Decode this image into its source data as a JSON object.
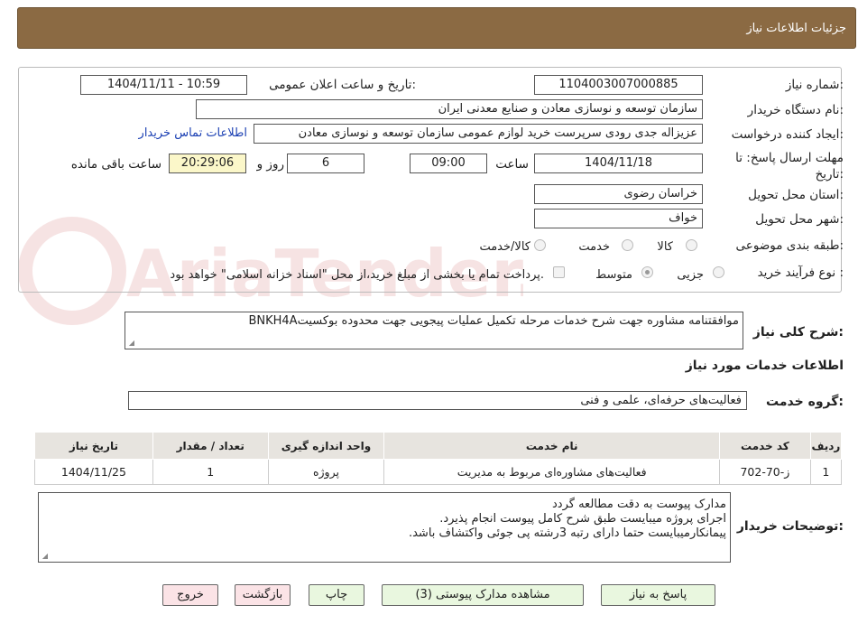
{
  "header": {
    "title": "جزئیات اطلاعات نیاز"
  },
  "form": {
    "need_number_label": "شماره نیاز:",
    "need_number": "1104003007000885",
    "announce_label": "تاریخ و ساعت اعلان عمومی:",
    "announce_value": "1404/11/11 - 10:59",
    "buyer_org_label": "نام دستگاه خریدار:",
    "buyer_org": "سازمان توسعه و نوسازی معادن و صنایع معدنی ایران",
    "requester_label": "ایجاد کننده درخواست:",
    "requester": "عزیزاله جدی رودی سرپرست خرید لوازم عمومی  سازمان توسعه و نوسازی معادن",
    "buyer_contact_link": "اطلاعات تماس خریدار",
    "deadline_label": "مهلت ارسال پاسخ: تا تاریخ:",
    "deadline_date": "1404/11/18",
    "time_label": "ساعت",
    "deadline_time": "09:00",
    "days_value": "6",
    "days_label": "روز و",
    "remaining_time": "20:29:06",
    "remaining_label": "ساعت باقی مانده",
    "province_label": "استان محل تحویل:",
    "province": "خراسان رضوی",
    "city_label": "شهر محل تحویل:",
    "city": "خواف",
    "category_label": "طبقه بندی موضوعی:",
    "category_options": [
      "کالا",
      "خدمت",
      "کالا/خدمت"
    ],
    "purchase_type_label": "نوع فرآیند خرید :",
    "purchase_type_options": [
      "جزیی",
      "متوسط"
    ],
    "treasury_note": "پرداخت تمام یا بخشی از مبلغ خرید،از محل \"اسناد خزانه اسلامی\" خواهد بود."
  },
  "summary": {
    "label": "شرح کلی نیاز:",
    "text": "موافقتنامه مشاوره جهت شرح خدمات مرحله تکمیل عملیات پیجویی جهت محدوده بوکسیتBNKH4A"
  },
  "services": {
    "section_title": "اطلاعات خدمات مورد نیاز",
    "group_label": "گروه خدمت:",
    "group_value": "فعالیت‌های حرفه‌ای، علمی و فنی",
    "columns": [
      "ردیف",
      "کد خدمت",
      "نام خدمت",
      "واحد اندازه گیری",
      "تعداد / مقدار",
      "تاریخ نیاز"
    ],
    "rows": [
      [
        "1",
        "ز-70-702",
        "فعالیت‌های مشاوره‌ای مربوط به مدیریت",
        "پروژه",
        "1",
        "1404/11/25"
      ]
    ]
  },
  "buyer_notes": {
    "label": "توضیحات خریدار:",
    "lines": [
      "مدارک پیوست به دقت مطالعه گردد",
      "اجرای پروژه میبایست طبق شرح کامل پیوست انجام پذیرد.",
      "پیمانکارمیبایست حتما دارای رتبه 3رشته پی جوئی واکتشاف باشد."
    ]
  },
  "buttons": {
    "reply": "پاسخ به نیاز",
    "attachments": "مشاهده مدارک پیوستی (3)",
    "print": "چاپ",
    "back": "بازگشت",
    "exit": "خروج"
  },
  "colors": {
    "header_bg": "#8b6a43",
    "link": "#1a3fb3",
    "button_green": "#e9f7df",
    "button_pink": "#fbe3e6"
  },
  "watermark_logo_text": "AriaTender.neT"
}
